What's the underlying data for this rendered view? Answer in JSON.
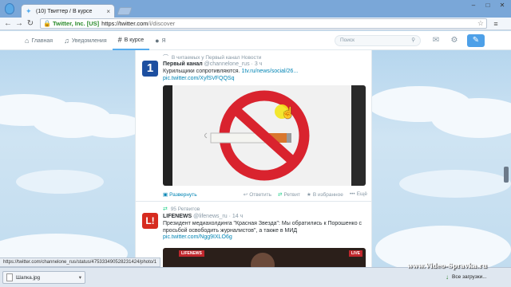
{
  "browser": {
    "tab_title": "(10) Твиттер / В курсе",
    "url_ev": "Twitter, Inc. [US]",
    "url_scheme_host": "https://twitter.com",
    "url_path": "/i/discover"
  },
  "twitter_nav": {
    "items": [
      {
        "label": "Главная",
        "icon": "home-icon"
      },
      {
        "label": "Уведомления",
        "icon": "bell-icon"
      },
      {
        "label": "В курсе",
        "icon": "hashtag-icon"
      },
      {
        "label": "Я",
        "icon": "person-icon"
      }
    ],
    "search_placeholder": "Поиск"
  },
  "tweet1": {
    "context": "В читаемых у Первый канал Новости",
    "name": "Первый канал",
    "handle": "@channelone_rus",
    "time": "· 3 ч",
    "text": "Курильщики сопротивляются.",
    "link1": "1tv.ru/news/social/26...",
    "link2": "pic.twitter.com/XyfSVFQQSq",
    "actions": {
      "expand": "Развернуть",
      "reply": "Ответить",
      "retweet": "Ретвит",
      "favorite": "В избранное",
      "more": "Ещё"
    }
  },
  "tweet2": {
    "context": "95 Ретвитов",
    "name": "LIFENEWS",
    "handle": "@lifenews_ru",
    "time": "· 14 ч",
    "text": "Президент медиахолдинга \"Красная Звезда\": Мы обратились к Порошенко с просьбой освободить журналистов\", а также в МИД",
    "link": "pic.twitter.com/Ngg9IXLO6g",
    "badge_left": "LIFENEWS",
    "badge_right": "LIVE"
  },
  "status_url": "https://twitter.com/channelone_rus/status/475333490528231424/photo/1",
  "downloads": {
    "file_name": "Шапка.jpg",
    "show_all": "Все загрузки..."
  },
  "watermark": "www.Video-Spravka.ru",
  "colors": {
    "twitter_blue": "#55acee",
    "link_blue": "#0084b4",
    "sign_red": "#d9232e"
  }
}
